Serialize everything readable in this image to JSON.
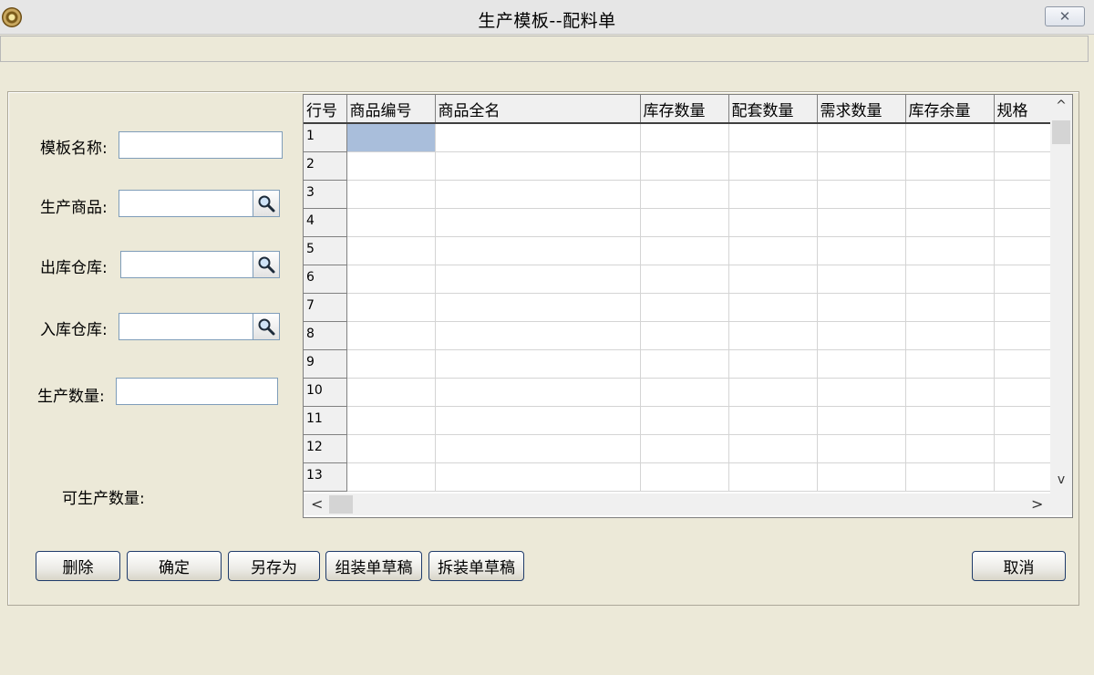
{
  "window": {
    "title": "生产模板--配料单",
    "close_glyph": "✕"
  },
  "form": {
    "template_name_label": "模板名称:",
    "template_name_value": "",
    "product_label": "生产商品:",
    "product_value": "",
    "out_warehouse_label": "出库仓库:",
    "out_warehouse_value": "",
    "in_warehouse_label": "入库仓库:",
    "in_warehouse_value": "",
    "quantity_label": "生产数量:",
    "quantity_value": "",
    "producible_label": "可生产数量:"
  },
  "grid": {
    "columns": [
      "行号",
      "商品编号",
      "商品全名",
      "库存数量",
      "配套数量",
      "需求数量",
      "库存余量",
      "规格"
    ],
    "rows": [
      "1",
      "2",
      "3",
      "4",
      "5",
      "6",
      "7",
      "8",
      "9",
      "10",
      "11",
      "12",
      "13"
    ],
    "selected_row": 1,
    "selected_column": "商品编号",
    "scroll_up": "^",
    "scroll_down": "v",
    "scroll_left": "<",
    "scroll_right": ">"
  },
  "buttons": {
    "delete": "删除",
    "confirm": "确定",
    "save_as": "另存为",
    "assembly_draft": "组装单草稿",
    "disassembly_draft": "拆装单草稿",
    "cancel": "取消"
  },
  "icons": {
    "app": "app-icon",
    "lookup": "search-icon",
    "close": "close-icon"
  },
  "colors": {
    "window_bg": "#ece9d8",
    "selected_cell": "#a9bedb",
    "header_bg": "#f0f0f0"
  }
}
